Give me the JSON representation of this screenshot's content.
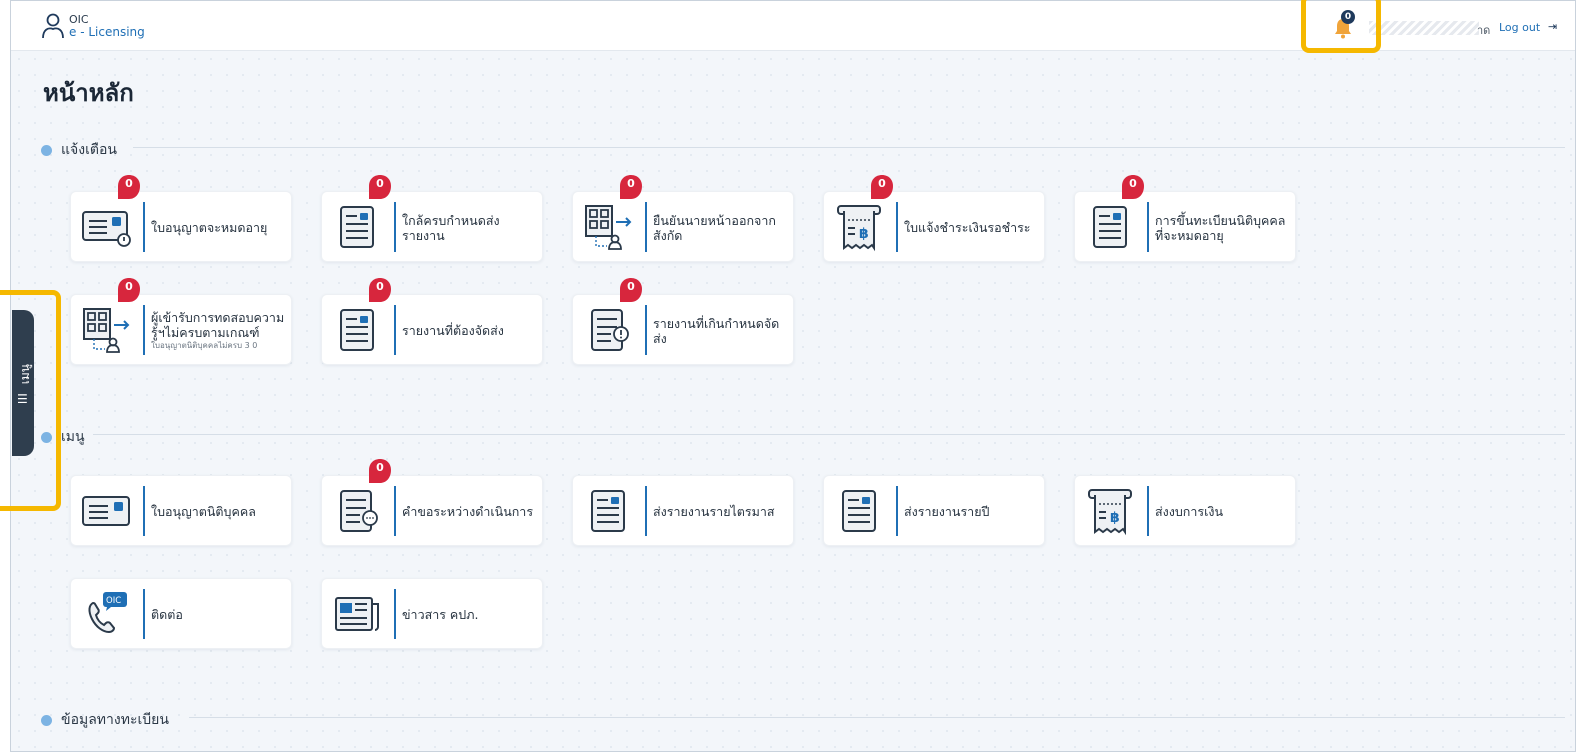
{
  "brand": {
    "line1": "OIC",
    "line2": "e - Licensing"
  },
  "header": {
    "notification_count": "0",
    "user_tail": "าด",
    "logout_label": "Log out",
    "logout_icon": "⇥"
  },
  "page": {
    "title": "หน้าหลัก"
  },
  "sections": {
    "alerts": "แจ้งเตือน",
    "menu": "เมนู",
    "registry": "ข้อมูลทางทะเบียน"
  },
  "alerts": [
    {
      "label": "ใบอนุญาตจะหมดอายุ",
      "badge": "0",
      "icon": "license-card-warning-icon"
    },
    {
      "label": "ใกล้ครบกำหนดส่งรายงาน",
      "badge": "0",
      "icon": "document-icon"
    },
    {
      "label": "ยืนยันนายหน้าออกจากสังกัด",
      "badge": "0",
      "icon": "building-person-icon"
    },
    {
      "label": "ใบแจ้งชำระเงินรอชำระ",
      "badge": "0",
      "icon": "receipt-baht-icon"
    },
    {
      "label": "การขึ้นทะเบียนนิติบุคคลที่จะหมดอายุ",
      "badge": "0",
      "icon": "document-icon"
    },
    {
      "label": "ผู้เข้ารับการทดสอบความรู้ฯไม่ครบตามเกณฑ์",
      "sub": "ใบอนุญาตนิติบุคคลไม่ครบ 3 0",
      "badge": "0",
      "icon": "building-person-icon"
    },
    {
      "label": "รายงานที่ต้องจัดส่ง",
      "badge": "0",
      "icon": "document-icon"
    },
    {
      "label": "รายงานที่เกินกำหนดจัดส่ง",
      "badge": "0",
      "icon": "document-warning-icon"
    }
  ],
  "menu": [
    {
      "label": "ใบอนุญาตนิติบุคคล",
      "icon": "license-card-icon"
    },
    {
      "label": "คำขอระหว่างดำเนินการ",
      "badge": "0",
      "icon": "document-chat-icon"
    },
    {
      "label": "ส่งรายงานรายไตรมาส",
      "icon": "document-icon"
    },
    {
      "label": "ส่งรายงานรายปี",
      "icon": "document-icon"
    },
    {
      "label": "ส่งงบการเงิน",
      "icon": "receipt-baht-icon"
    },
    {
      "label": "ติดต่อ",
      "icon": "phone-oic-icon"
    },
    {
      "label": "ข่าวสาร คปภ.",
      "icon": "newspaper-icon"
    }
  ],
  "phone_icon_text": "OIC",
  "side_tab": {
    "label": "เมนู",
    "icon": "hamburger-icon"
  },
  "colors": {
    "accent": "#1f6fb5",
    "badge": "#d7263d",
    "highlight": "#f5b800",
    "sidebar": "#2f3e4e"
  }
}
